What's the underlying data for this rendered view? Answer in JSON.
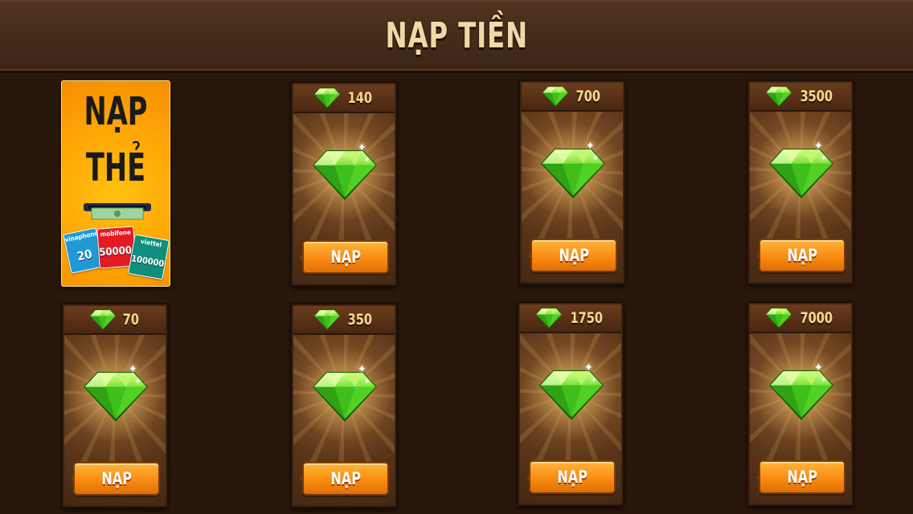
{
  "header": {
    "title": "NẠP TIỀN"
  },
  "promo": {
    "line1": "NẠP",
    "line2": "THẺ",
    "cards": [
      {
        "label": "vinaphone",
        "value": "20"
      },
      {
        "label": "mobifone",
        "value": "50000đ"
      },
      {
        "label": "viettel",
        "value": "100000đ"
      }
    ]
  },
  "packs": [
    {
      "amount": "140",
      "button": "NẠP"
    },
    {
      "amount": "700",
      "button": "NẠP"
    },
    {
      "amount": "3500",
      "button": "NẠP"
    },
    {
      "amount": "70",
      "button": "NẠP"
    },
    {
      "amount": "350",
      "button": "NẠP"
    },
    {
      "amount": "1750",
      "button": "NẠP"
    },
    {
      "amount": "7000",
      "button": "NẠP"
    }
  ],
  "colors": {
    "background": "#2a170c",
    "header": "#4f3420",
    "button": "#f98c11",
    "gem": "#4ee22a",
    "amount_text": "#f6dc8f",
    "promo": "#ffaa07"
  },
  "icons": {
    "gem": "green-gem-icon",
    "sparkle": "sparkle-icon",
    "card_slot": "card-reader-icon"
  }
}
